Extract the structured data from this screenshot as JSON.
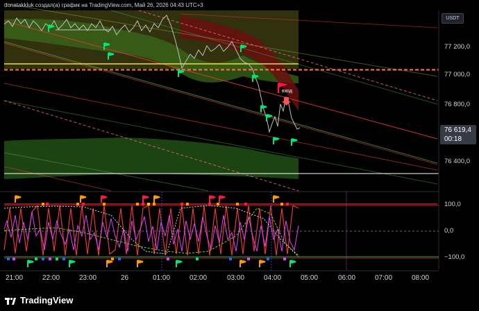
{
  "header": {
    "caption": "donatakkluk создал(а) график на TradingView.com, Май 26, 2026 04:43 UTC+3"
  },
  "price_axis": {
    "currency": "USDT",
    "labels": [
      "77 200,0",
      "77 000,0",
      "76 800,0",
      "76 400,0"
    ],
    "current_price": "76 619,4",
    "countdown": "00:18"
  },
  "oscillator_axis": {
    "labels": [
      "100,0",
      "0,0",
      "−100,0"
    ]
  },
  "time_axis": {
    "labels": [
      "21:00",
      "22:00",
      "23:00",
      "26",
      "01:00",
      "02:00",
      "03:00",
      "04:00",
      "05:00",
      "06:00",
      "07:00",
      "08:00"
    ]
  },
  "annotations": {
    "entry": "вход"
  },
  "footer": {
    "brand": "TradingView"
  },
  "colors": {
    "background": "#000000",
    "price_line": "#c0c0c0",
    "channel_red": "#ff3b3b",
    "channel_green": "#3bd15b",
    "yellow_line": "#f5d742",
    "oscillator_pink": "#e040fb",
    "oscillator_red": "#ff1744",
    "flag_green": "#00e676",
    "flag_red": "#ff1744",
    "flag_orange": "#ff9800"
  },
  "chart_data": [
    {
      "type": "line",
      "title": "",
      "x": [
        "21:00",
        "22:00",
        "23:00",
        "26",
        "01:00",
        "02:00",
        "03:00",
        "04:00",
        "05:00",
        "06:00",
        "07:00",
        "08:00"
      ],
      "series": [
        {
          "values": [
            77290,
            77260,
            77230,
            77250,
            77320,
            77180,
            77080,
            77150,
            77080,
            76980,
            76850,
            76740,
            76500,
            76620
          ]
        }
      ],
      "ylim": [
        76200,
        77400
      ],
      "annotations": [
        "вход"
      ]
    },
    {
      "type": "line",
      "title": "",
      "ylim": [
        -120,
        120
      ],
      "yticks": [
        100,
        0,
        -100
      ]
    }
  ]
}
